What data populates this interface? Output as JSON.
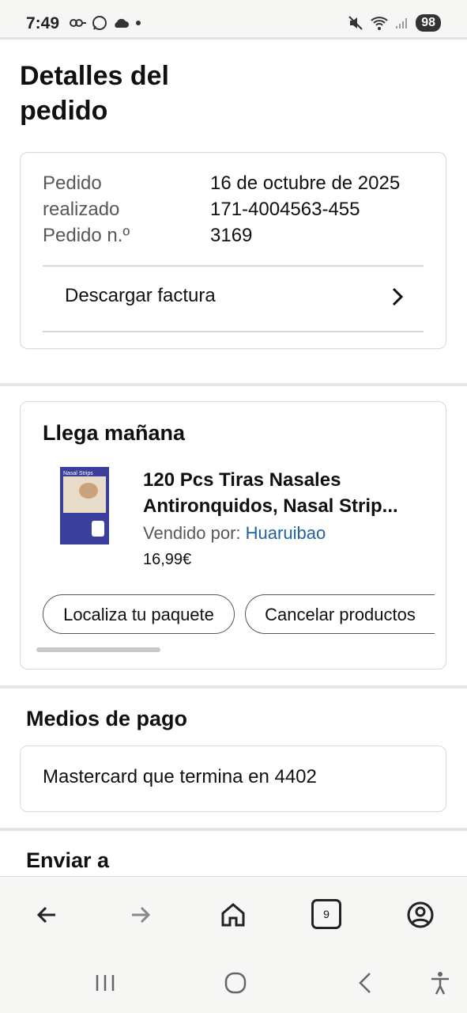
{
  "status_bar": {
    "time": "7:49",
    "battery": "98"
  },
  "page": {
    "title": "Detalles del pedido"
  },
  "order": {
    "placed_label": "Pedido realizado",
    "placed_value": "16 de octubre de 2025",
    "number_label": "Pedido n.º",
    "number_value": "171-4004563-4553169",
    "invoice_label": "Descargar factura"
  },
  "delivery": {
    "title": "Llega mañana",
    "product": {
      "title_line1": "120 Pcs Tiras Nasales",
      "title_line2": "Antironquidos, Nasal Strip...",
      "seller_prefix": "Vendido por:",
      "seller_name": "Huaruibao",
      "price": "16,99€",
      "image_text": "Nasal Strips"
    },
    "buttons": {
      "track": "Localiza tu paquete",
      "cancel": "Cancelar productos"
    }
  },
  "payment": {
    "title": "Medios de pago",
    "method": "Mastercard  que termina en 4402"
  },
  "shipping": {
    "title": "Enviar a"
  },
  "browser_nav": {
    "tab_count": "9"
  },
  "colors": {
    "link": "#2162a1",
    "border": "#d5d9d9",
    "muted_text": "#565959"
  }
}
